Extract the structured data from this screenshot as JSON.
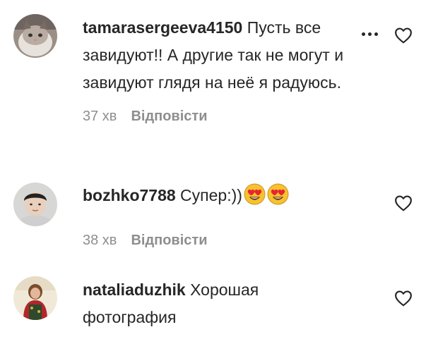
{
  "comments": [
    {
      "username": "tamarasergeeva4150",
      "text": "Пусть все завидуют!! А другие так не могут и завидуют глядя на неё я радуюсь.",
      "time": "37 хв",
      "reply_label": "Відповісти",
      "avatar_icon": "cat-avatar-icon"
    },
    {
      "username": "bozhko7788",
      "text": "Супер:))",
      "emojis": [
        "heart-eyes-emoji",
        "heart-eyes-emoji"
      ],
      "time": "38 хв",
      "reply_label": "Відповісти",
      "avatar_icon": "child-avatar-icon"
    },
    {
      "username": "nataliaduzhik",
      "text": "Хорошая фотография",
      "avatar_icon": "woman-avatar-icon"
    }
  ],
  "icons": {
    "like": "heart-outline-icon",
    "more": "more-options-icon"
  },
  "colors": {
    "text": "#262626",
    "secondary": "#8e8e8e",
    "background": "#ffffff"
  }
}
